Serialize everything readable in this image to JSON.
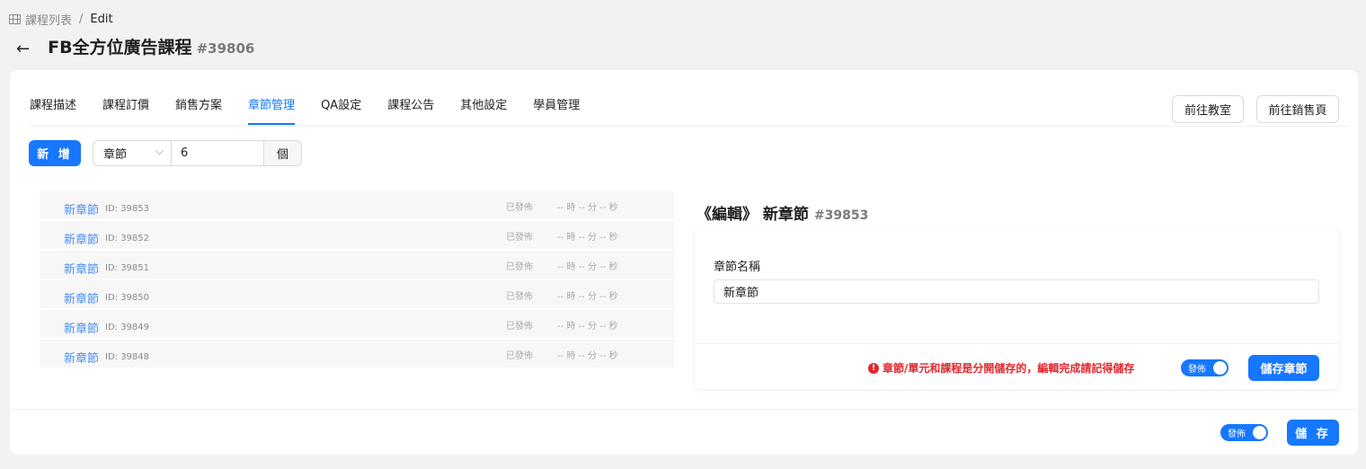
{
  "breadcrumb": {
    "icon": "table-icon",
    "parent": "課程列表",
    "separator": "/",
    "current": "Edit"
  },
  "header": {
    "title": "FB全方位廣告課程",
    "id": "#39806"
  },
  "tabs": [
    {
      "label": "課程描述",
      "active": false
    },
    {
      "label": "課程訂價",
      "active": false
    },
    {
      "label": "銷售方案",
      "active": false
    },
    {
      "label": "章節管理",
      "active": true
    },
    {
      "label": "QA設定",
      "active": false
    },
    {
      "label": "課程公告",
      "active": false
    },
    {
      "label": "其他設定",
      "active": false
    },
    {
      "label": "學員管理",
      "active": false
    }
  ],
  "header_buttons": {
    "classroom": "前往教室",
    "sales_page": "前往銷售頁"
  },
  "toolbar": {
    "add_label": "新 增",
    "type_value": "章節",
    "count_value": "6",
    "count_unit": "個"
  },
  "chapters": [
    {
      "name": "新章節",
      "id": "ID: 39853",
      "status": "已發佈",
      "duration": "-- 時 -- 分 -- 秒"
    },
    {
      "name": "新章節",
      "id": "ID: 39852",
      "status": "已發佈",
      "duration": "-- 時 -- 分 -- 秒"
    },
    {
      "name": "新章節",
      "id": "ID: 39851",
      "status": "已發佈",
      "duration": "-- 時 -- 分 -- 秒"
    },
    {
      "name": "新章節",
      "id": "ID: 39850",
      "status": "已發佈",
      "duration": "-- 時 -- 分 -- 秒"
    },
    {
      "name": "新章節",
      "id": "ID: 39849",
      "status": "已發佈",
      "duration": "-- 時 -- 分 -- 秒"
    },
    {
      "name": "新章節",
      "id": "ID: 39848",
      "status": "已發佈",
      "duration": "-- 時 -- 分 -- 秒"
    }
  ],
  "editor": {
    "title": "《編輯》 新章節",
    "id": "#39853",
    "field_label": "章節名稱",
    "field_value": "新章節",
    "warning": "章節/單元和課程是分開儲存的，編輯完成請記得儲存",
    "publish_toggle": {
      "label": "發佈",
      "on": true
    },
    "save_label": "儲存章節"
  },
  "footer": {
    "publish_toggle": {
      "label": "發佈",
      "on": true
    },
    "save_label": "儲 存"
  },
  "colors": {
    "primary": "#1677ff",
    "link": "#4b8ff6",
    "warning": "#e0282e"
  }
}
